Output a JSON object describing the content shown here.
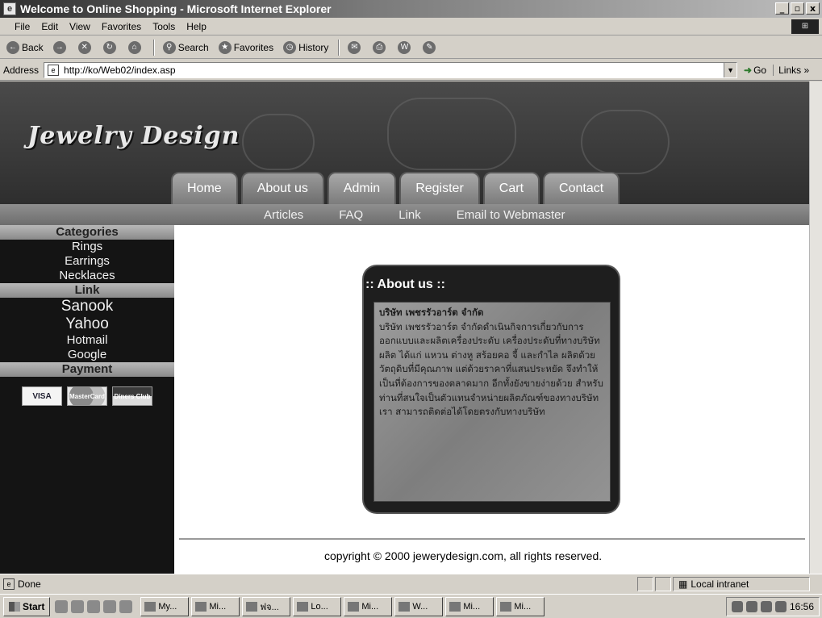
{
  "window": {
    "title": "Welcome to Online Shopping - Microsoft Internet Explorer",
    "controls": [
      "_",
      "▫",
      "x"
    ]
  },
  "menu": [
    "File",
    "Edit",
    "View",
    "Favorites",
    "Tools",
    "Help"
  ],
  "toolbar": {
    "back": "Back",
    "search": "Search",
    "favorites": "Favorites",
    "history": "History"
  },
  "address": {
    "label": "Address",
    "url": "http://ko/Web02/index.asp",
    "go": "Go",
    "links": "Links »"
  },
  "site": {
    "logo": "Jewelry Design",
    "tabs": [
      "Home",
      "About us",
      "Admin",
      "Register",
      "Cart",
      "Contact"
    ],
    "subnav": [
      "Articles",
      "FAQ",
      "Link",
      "Email to Webmaster"
    ],
    "sidebar": {
      "categories_head": "Categories",
      "categories": [
        "Rings",
        "Earrings",
        "Necklaces"
      ],
      "link_head": "Link",
      "links": [
        "Sanook",
        "Yahoo",
        "Hotmail",
        "Google"
      ],
      "payment_head": "Payment",
      "cards": [
        "VISA",
        "MasterCard",
        "Diners Club"
      ]
    },
    "about": {
      "title": ":: About us ::",
      "heading": "บริษัท เพชรรัวอาร์ต จำกัด",
      "body": "บริษัท เพชรรัวอาร์ต จำกัดดำเนินกิจการเกี่ยวกับการออกแบบและผลิตเครื่องประดับ เครื่องประดับที่ทางบริษัทผลิต ได้แก่ แหวน ต่างหู สร้อยคอ จี้ และกำไล ผลิตด้วยวัตถุดิบที่มีคุณภาพ แต่ด้วยราคาที่แสนประหยัด จึงทำให้เป็นที่ต้องการของตลาดมาก อีกทั้งยังขายง่ายด้วย สำหรับท่านที่สนใจเป็นตัวแทนจำหน่ายผลิตภัณฑ์ของทางบริษัทเรา สามารถติดต่อได้โดยตรงกับทางบริษัท"
    },
    "copyright": "copyright © 2000 jewerydesign.com, all rights reserved."
  },
  "status": {
    "text": "Done",
    "zone": "Local intranet"
  },
  "taskbar": {
    "start": "Start",
    "items": [
      "My...",
      "Mi...",
      "ฟจ...",
      "Lo...",
      "Mi...",
      "W...",
      "Mi...",
      "Mi..."
    ],
    "clock": "16:56"
  }
}
